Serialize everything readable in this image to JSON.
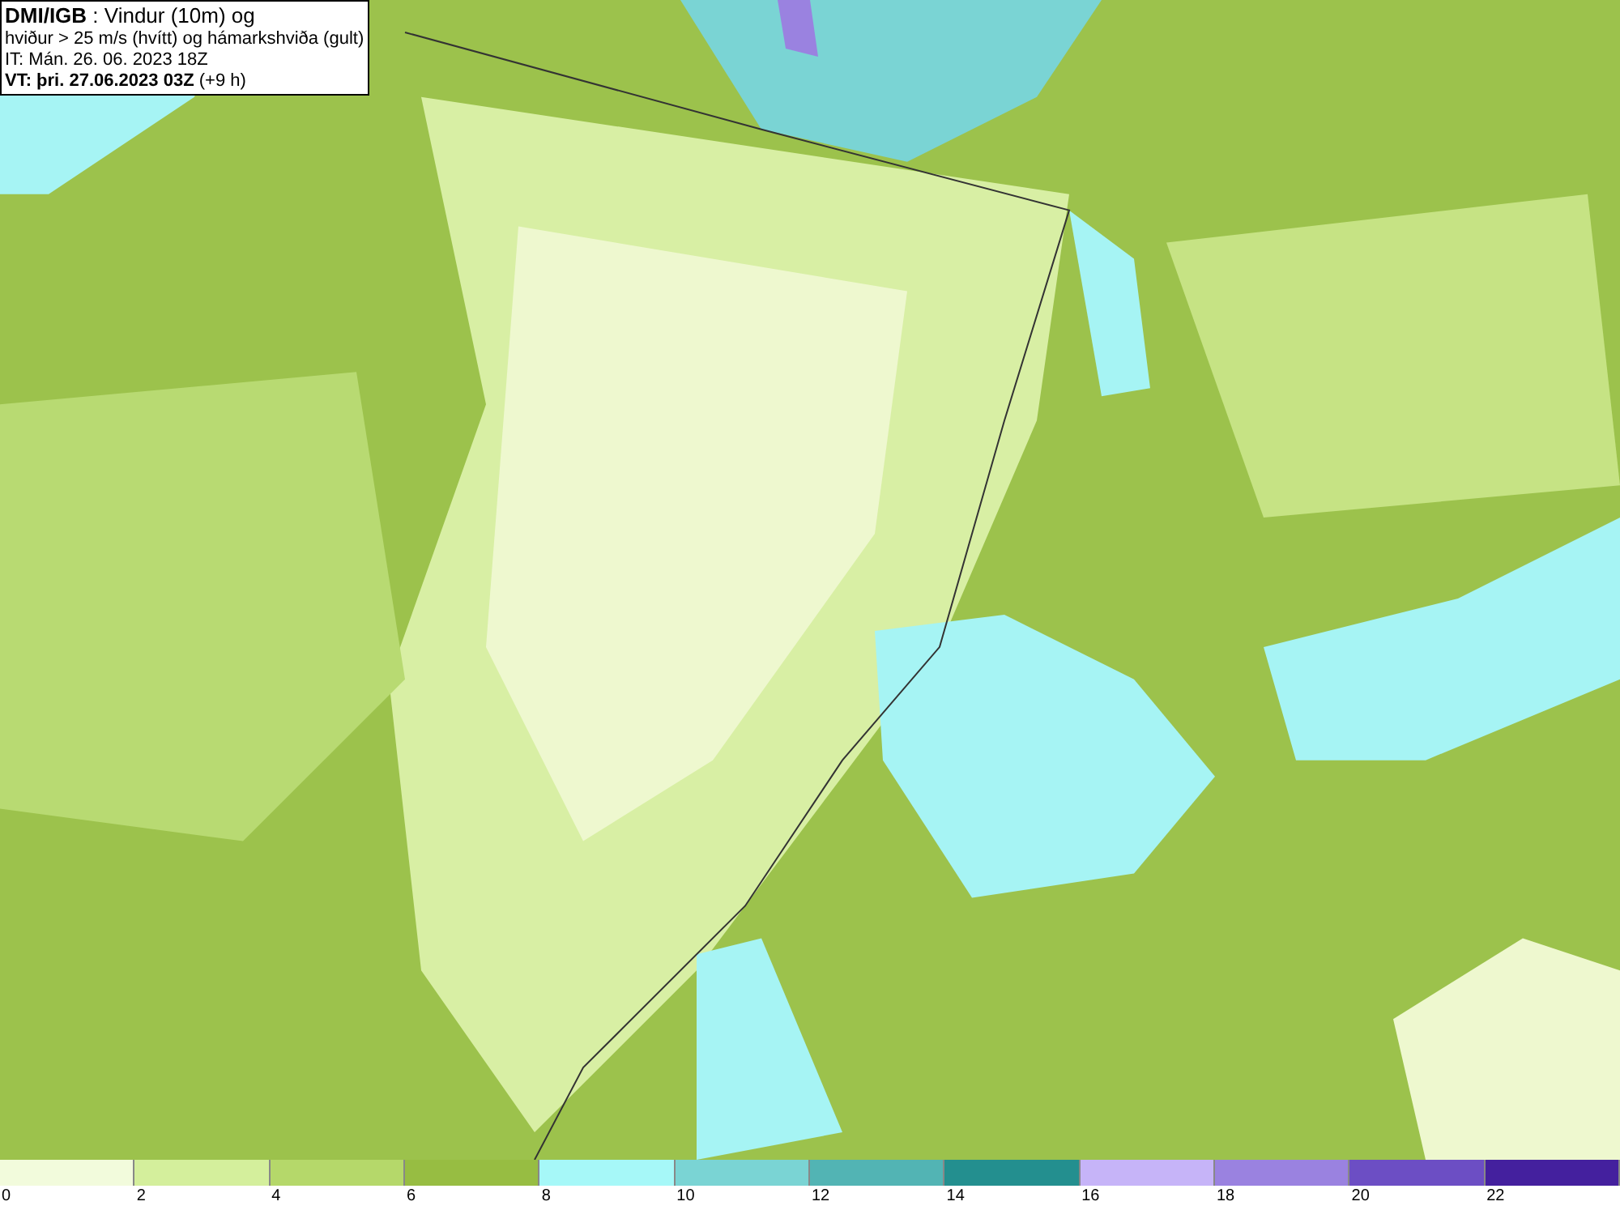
{
  "title_box": {
    "lines": [
      "**DMI/IGB** : Vindur (10m) og",
      "hviður > 25 m/s (hvítt) og hámarkshviða (gult)",
      "IT: Mán. 26. 06. 2023 18Z",
      "**VT: þri. 27.06.2023 03Z** (+9 h)"
    ]
  },
  "legend": {
    "segments": [
      {
        "color": "#f2fbdc"
      },
      {
        "color": "#d4ef9c"
      },
      {
        "color": "#b5d86a"
      },
      {
        "color": "#97bd42"
      },
      {
        "color": "#a6f8f8"
      },
      {
        "color": "#7ad4d4"
      },
      {
        "color": "#52b4b4"
      },
      {
        "color": "#238f8f"
      },
      {
        "color": "#c6b4f8"
      },
      {
        "color": "#9a82e0"
      },
      {
        "color": "#6c4ec4"
      },
      {
        "color": "#44209e"
      }
    ],
    "ticks": [
      "0",
      "2",
      "4",
      "6",
      "8",
      "10",
      "12",
      "14",
      "16",
      "18",
      "20",
      "22"
    ]
  }
}
